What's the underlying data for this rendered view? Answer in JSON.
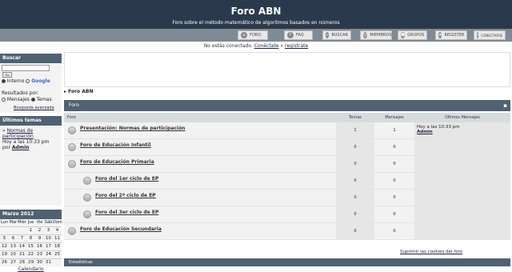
{
  "header": {
    "title": "Foro ABN",
    "subtitle": "Foro sobre el método matemático de algoritmos basados en números"
  },
  "nav": [
    {
      "label": "FORO",
      "icon": "home-icon"
    },
    {
      "label": "FAQ",
      "icon": "question-icon"
    },
    {
      "label": "BUSCAR",
      "icon": "search-icon"
    },
    {
      "label": "MIEMBROS",
      "icon": "members-icon"
    },
    {
      "label": "GRUPOS",
      "icon": "groups-icon"
    },
    {
      "label": "REGISTER",
      "icon": "register-star-icon"
    },
    {
      "label": "CONECTARSE",
      "icon": "key-icon"
    }
  ],
  "status": {
    "prefix": "No estás conectado.",
    "login": "Conéctate",
    "separator": "»",
    "register": "registrate"
  },
  "sidebar": {
    "search": {
      "title": "Buscar",
      "button": "Go",
      "opt_internal": "Interno",
      "opt_google": "Google",
      "results_label": "Resultados por:",
      "opt_messages": "Mensajes",
      "opt_topics": "Temas",
      "advanced": "Búsqueda avanzada"
    },
    "latest": {
      "title": "Últimos temas",
      "topic": "Normas de participación",
      "time": "Hoy a las 10:33 pm",
      "by": "por",
      "author": "Admin"
    },
    "calendar": {
      "title": "Marzo 2012",
      "days": [
        "Lun",
        "Mar",
        "Miér",
        "Jue",
        "Vie",
        "Sáb",
        "Dom"
      ],
      "cells": [
        "",
        "",
        "",
        "1",
        "2",
        "3",
        "4",
        "5",
        "6",
        "7",
        "8",
        "9",
        "10",
        "11",
        "12",
        "13",
        "14",
        "15",
        "16",
        "17",
        "18",
        "19",
        "20",
        "21",
        "22",
        "23",
        "24",
        "25",
        "26",
        "27",
        "28",
        "29",
        "30",
        "31",
        ""
      ],
      "link": "Calendario"
    }
  },
  "main": {
    "breadcrumb": "Foro ABN",
    "section_title": "Foro",
    "columns": {
      "forum": "Foro",
      "topics": "Temas",
      "posts": "Mensajes",
      "last": "Últimos Mensajes"
    },
    "rows": [
      {
        "name": "Presentación: Normas de participación",
        "topics": "1",
        "posts": "1",
        "last_time": "Hoy a las 10:33 pm",
        "last_author": "Admin",
        "level": 0
      },
      {
        "name": "Foro de Educación Infantil",
        "topics": "0",
        "posts": "0",
        "last_time": "",
        "last_author": "",
        "level": 0
      },
      {
        "name": "Foro de Educación Primaria",
        "topics": "0",
        "posts": "0",
        "last_time": "",
        "last_author": "",
        "level": 0
      },
      {
        "name": "Foro del 1er ciclo de EP",
        "topics": "0",
        "posts": "0",
        "last_time": "",
        "last_author": "",
        "level": 1
      },
      {
        "name": "Foro del 2º ciclo de EP",
        "topics": "0",
        "posts": "0",
        "last_time": "",
        "last_author": "",
        "level": 1
      },
      {
        "name": "Foro del 3er ciclo de EP",
        "topics": "0",
        "posts": "0",
        "last_time": "",
        "last_author": "",
        "level": 1
      },
      {
        "name": "Foro de Educación Secundaria",
        "topics": "0",
        "posts": "0",
        "last_time": "",
        "last_author": "",
        "level": 0
      }
    ],
    "cookies_link": "Suprimir las cookies del foro",
    "stats_title": "Estadísticas"
  }
}
